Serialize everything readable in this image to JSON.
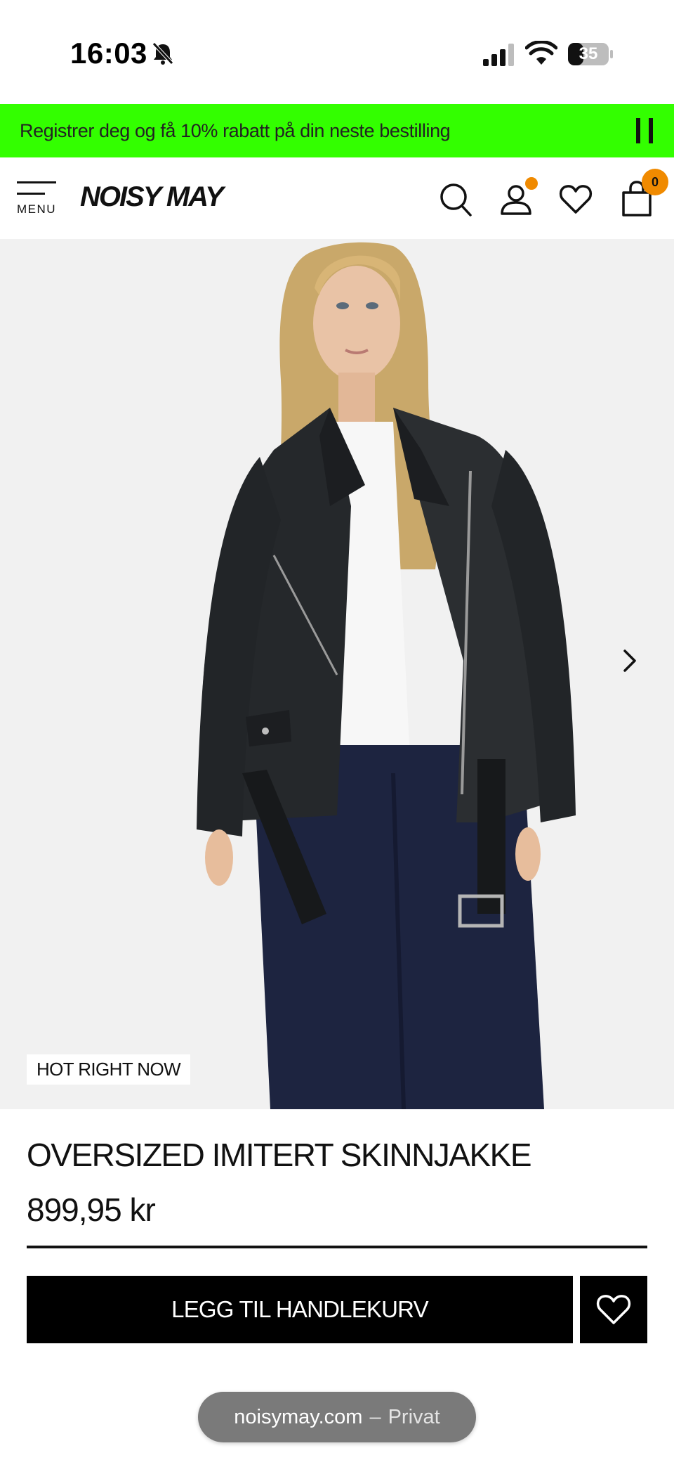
{
  "status_bar": {
    "time": "16:03",
    "battery": "35",
    "icons": [
      "bell-muted-icon",
      "cellular-signal-icon",
      "wifi-icon",
      "battery-icon"
    ]
  },
  "promo": {
    "text": "Registrer deg og få 10% rabatt på din neste bestilling",
    "background": "#33ff00"
  },
  "header": {
    "menu_label": "MENU",
    "logo": "NOISY MAY",
    "cart_count": "0",
    "accent": "#f08a00",
    "icons": [
      "search-icon",
      "account-icon",
      "heart-icon",
      "shopping-bag-icon"
    ]
  },
  "product": {
    "badge": "HOT RIGHT NOW",
    "title": "OVERSIZED IMITERT SKINNJAKKE",
    "price": "899,95 kr",
    "add_to_cart_label": "LEGG TIL HANDLEKURV"
  },
  "browser": {
    "domain": "noisymay.com",
    "separator": "–",
    "mode": "Privat"
  }
}
